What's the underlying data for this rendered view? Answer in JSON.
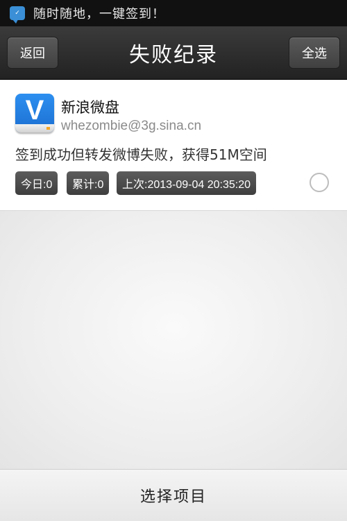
{
  "status_bar": {
    "icon": "chat-bubble-icon",
    "notification_text": "随时随地，一键签到！"
  },
  "header": {
    "back_label": "返回",
    "title": "失败纪录",
    "select_all_label": "全选"
  },
  "record": {
    "app_icon": "vdisk-logo-icon",
    "app_name": "新浪微盘",
    "account": "whezombie@3g.sina.cn",
    "message": "签到成功但转发微博失败，获得51M空间",
    "badges": {
      "today": "今日:0",
      "total": "累计:0",
      "last": "上次:2013-09-04 20:35:20"
    },
    "selected": false
  },
  "footer": {
    "select_items_label": "选择项目"
  },
  "colors": {
    "header_bg": "#2c2c2c",
    "badge_bg": "#4a4a4a",
    "app_icon_blue": "#2d8ff0"
  }
}
